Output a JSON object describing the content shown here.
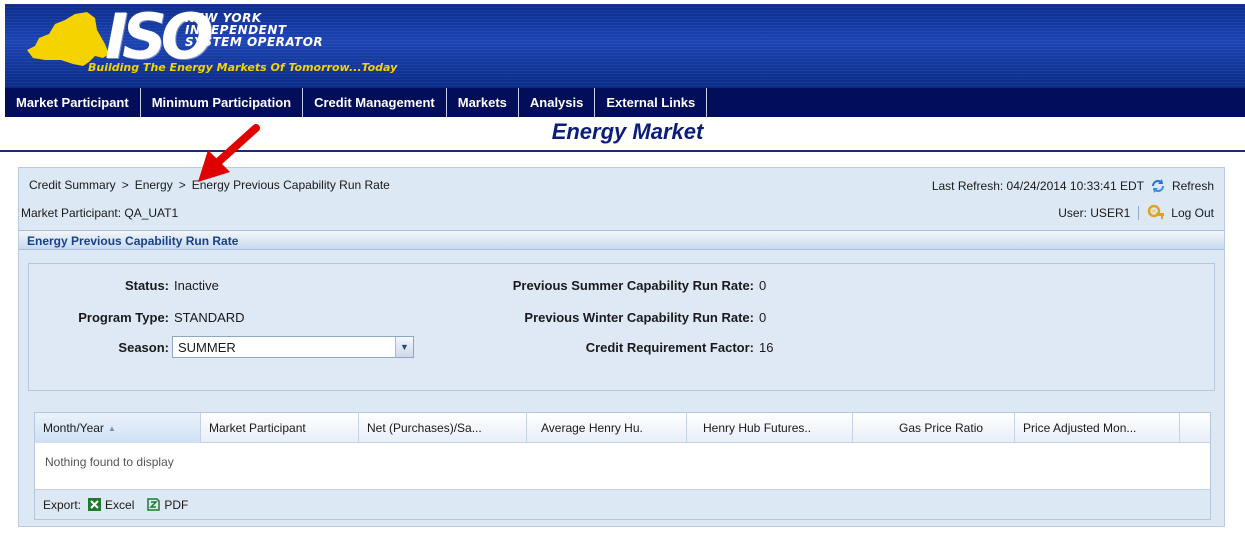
{
  "banner": {
    "logo_text": "ISO",
    "org_line1": "NEW YORK",
    "org_line2": "INDEPENDENT",
    "org_line3": "SYSTEM OPERATOR",
    "tagline": "Building The Energy Markets Of Tomorrow...Today"
  },
  "nav": {
    "items": [
      {
        "label": "Market Participant"
      },
      {
        "label": "Minimum Participation"
      },
      {
        "label": "Credit Management"
      },
      {
        "label": "Markets"
      },
      {
        "label": "Analysis"
      },
      {
        "label": "External Links"
      }
    ]
  },
  "page": {
    "title": "Energy Market"
  },
  "breadcrumb": {
    "items": [
      "Credit Summary",
      "Energy",
      "Energy Previous Capability Run Rate"
    ],
    "separator": ">"
  },
  "header_info": {
    "market_participant": "Market Participant: QA_UAT1",
    "last_refresh": "Last Refresh: 04/24/2014 10:33:41 EDT",
    "refresh_label": "Refresh",
    "user": "User: USER1",
    "logout_label": "Log Out"
  },
  "section": {
    "title": "Energy Previous Capability Run Rate"
  },
  "details": {
    "status_label": "Status:",
    "status_value": "Inactive",
    "program_type_label": "Program Type:",
    "program_type_value": "STANDARD",
    "season_label": "Season:",
    "season_value": "SUMMER",
    "prev_summer_label": "Previous Summer Capability Run Rate:",
    "prev_summer_value": "0",
    "prev_winter_label": "Previous Winter Capability Run Rate:",
    "prev_winter_value": "0",
    "credit_factor_label": "Credit Requirement Factor:",
    "credit_factor_value": "16"
  },
  "grid": {
    "columns": [
      "Month/Year",
      "Market Participant",
      "Net (Purchases)/Sa...",
      "Average Henry Hu.",
      "Henry Hub Futures..",
      "Gas Price Ratio",
      "Price Adjusted Mon..."
    ],
    "sort_indicator": "▲",
    "empty_message": "Nothing found to display",
    "export_label": "Export:",
    "export_excel": "Excel",
    "export_pdf": "PDF"
  },
  "colors": {
    "nav_bg": "#030e5a",
    "banner_bg": "#1c44b4",
    "title": "#0a1e78",
    "panel_bg": "#dde8f5",
    "section_title": "#15428b",
    "annotation_arrow": "#e00000"
  }
}
